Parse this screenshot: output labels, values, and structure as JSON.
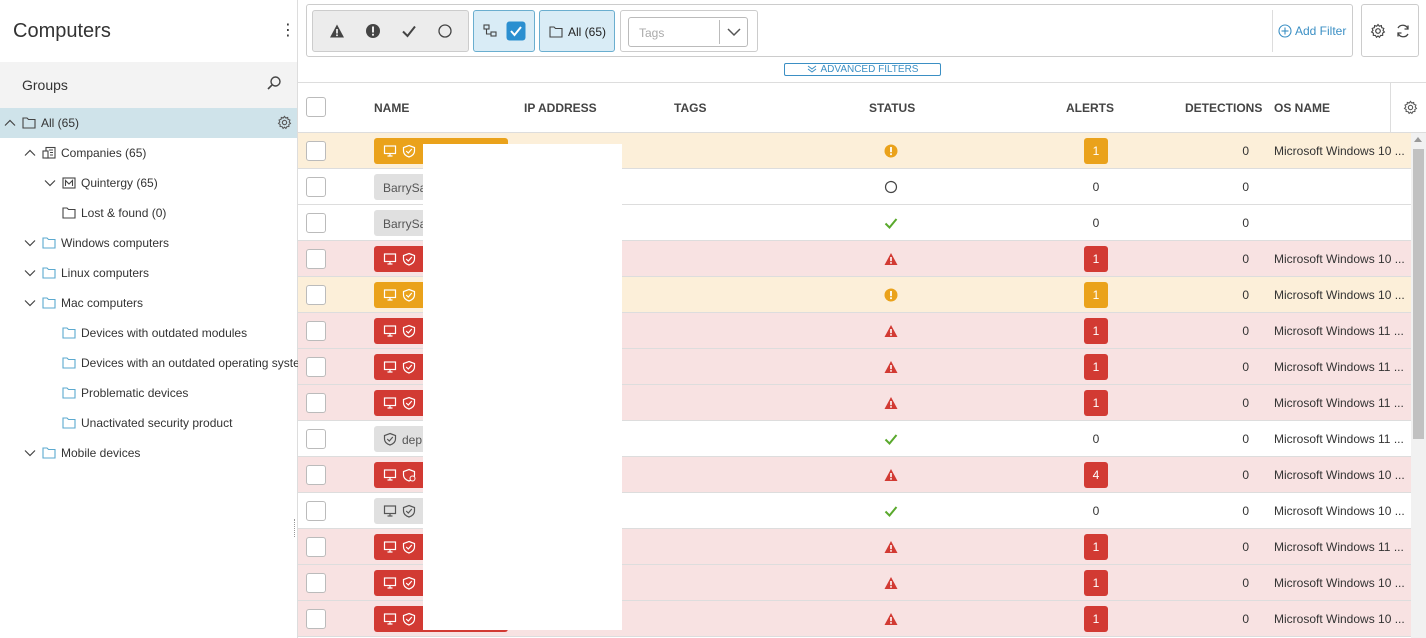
{
  "sidebar": {
    "title": "Computers",
    "groups_label": "Groups",
    "tree": [
      {
        "label": "All (65)",
        "icon": "folder-icon",
        "chevron": "up",
        "indent": 0,
        "selected": true
      },
      {
        "label": "Companies (65)",
        "icon": "companies-icon",
        "chevron": "up",
        "indent": 1
      },
      {
        "label": "Quintergy (65)",
        "icon": "company-icon",
        "chevron": "down",
        "indent": 2
      },
      {
        "label": "Lost & found (0)",
        "icon": "folder-icon",
        "chevron": "",
        "indent": 2
      },
      {
        "label": "Windows computers",
        "icon": "dynamic-folder-icon",
        "chevron": "down",
        "indent": 1
      },
      {
        "label": "Linux computers",
        "icon": "dynamic-folder-icon",
        "chevron": "down",
        "indent": 1
      },
      {
        "label": "Mac computers",
        "icon": "dynamic-folder-icon",
        "chevron": "down",
        "indent": 1
      },
      {
        "label": "Devices with outdated modules",
        "icon": "dynamic-folder-icon",
        "chevron": "",
        "indent": 2
      },
      {
        "label": "Devices with an outdated operating system",
        "icon": "dynamic-folder-icon",
        "chevron": "",
        "indent": 2
      },
      {
        "label": "Problematic devices",
        "icon": "dynamic-folder-icon",
        "chevron": "",
        "indent": 2
      },
      {
        "label": "Unactivated security product",
        "icon": "dynamic-folder-icon",
        "chevron": "",
        "indent": 2
      },
      {
        "label": "Mobile devices",
        "icon": "dynamic-folder-icon",
        "chevron": "down",
        "indent": 1
      }
    ]
  },
  "toolbar": {
    "all_label": "All (65)",
    "tags_placeholder": "Tags",
    "add_filter_label": "Add Filter",
    "advanced_filters_label": "ADVANCED FILTERS"
  },
  "table": {
    "columns": {
      "name": "NAME",
      "ip": "IP ADDRESS",
      "tags": "TAGS",
      "status": "STATUS",
      "alerts": "ALERTS",
      "detections": "DETECTIONS",
      "os": "OS NAME"
    },
    "rows": [
      {
        "state": "warn",
        "pill": "orange",
        "name": "",
        "icons": [
          "monitor",
          "shield"
        ],
        "status": "exclamation",
        "alerts": "1",
        "alert_style": "orange",
        "detections": "0",
        "os": "Microsoft Windows 10 ..."
      },
      {
        "state": "ok",
        "pill": "gray",
        "name": "BarrySa",
        "icons": [],
        "status": "circle",
        "alerts": "0",
        "alert_style": "plain",
        "detections": "0",
        "os": ""
      },
      {
        "state": "ok",
        "pill": "gray",
        "name": "BarrySa",
        "icons": [],
        "status": "check",
        "alerts": "0",
        "alert_style": "plain",
        "detections": "0",
        "os": ""
      },
      {
        "state": "err",
        "pill": "red",
        "name": "",
        "icons": [
          "monitor",
          "shield"
        ],
        "status": "warning",
        "alerts": "1",
        "alert_style": "red",
        "detections": "0",
        "os": "Microsoft Windows 10 ..."
      },
      {
        "state": "warn",
        "pill": "orange",
        "name": "",
        "icons": [
          "monitor",
          "shield"
        ],
        "status": "exclamation",
        "alerts": "1",
        "alert_style": "orange",
        "detections": "0",
        "os": "Microsoft Windows 10 ..."
      },
      {
        "state": "err",
        "pill": "red",
        "name": "",
        "icons": [
          "monitor",
          "shield"
        ],
        "status": "warning",
        "alerts": "1",
        "alert_style": "red",
        "detections": "0",
        "os": "Microsoft Windows 11 ..."
      },
      {
        "state": "err",
        "pill": "red",
        "name": "",
        "icons": [
          "monitor",
          "shield"
        ],
        "status": "warning",
        "alerts": "1",
        "alert_style": "red",
        "detections": "0",
        "os": "Microsoft Windows 11 ..."
      },
      {
        "state": "err",
        "pill": "red",
        "name": "",
        "icons": [
          "monitor",
          "shield"
        ],
        "status": "warning",
        "alerts": "1",
        "alert_style": "red",
        "detections": "0",
        "os": "Microsoft Windows 11 ..."
      },
      {
        "state": "ok",
        "pill": "gray",
        "name": "dep",
        "icons": [
          "shield"
        ],
        "status": "check",
        "alerts": "0",
        "alert_style": "plain",
        "detections": "0",
        "os": "Microsoft Windows 11 ..."
      },
      {
        "state": "err",
        "pill": "red",
        "name": "",
        "icons": [
          "monitor",
          "shield-gear"
        ],
        "status": "warning",
        "alerts": "4",
        "alert_style": "red",
        "detections": "0",
        "os": "Microsoft Windows 10 ..."
      },
      {
        "state": "ok",
        "pill": "gray",
        "name": "",
        "icons": [
          "monitor",
          "shield"
        ],
        "status": "check",
        "alerts": "0",
        "alert_style": "plain",
        "detections": "0",
        "os": "Microsoft Windows 10 ..."
      },
      {
        "state": "err",
        "pill": "red",
        "name": "",
        "icons": [
          "monitor",
          "shield"
        ],
        "status": "warning",
        "alerts": "1",
        "alert_style": "red",
        "detections": "0",
        "os": "Microsoft Windows 11 ..."
      },
      {
        "state": "err",
        "pill": "red",
        "name": "",
        "icons": [
          "monitor",
          "shield"
        ],
        "status": "warning",
        "alerts": "1",
        "alert_style": "red",
        "detections": "0",
        "os": "Microsoft Windows 10 ..."
      },
      {
        "state": "err",
        "pill": "red",
        "name": "",
        "icons": [
          "monitor",
          "shield"
        ],
        "status": "warning",
        "alerts": "1",
        "alert_style": "red",
        "detections": "0",
        "os": "Microsoft Windows 10 ..."
      }
    ]
  },
  "colors": {
    "warning_orange": "#eaa21b",
    "error_red": "#d23a33",
    "ok_green": "#5aa92d",
    "accent_blue": "#3b8fc4"
  }
}
